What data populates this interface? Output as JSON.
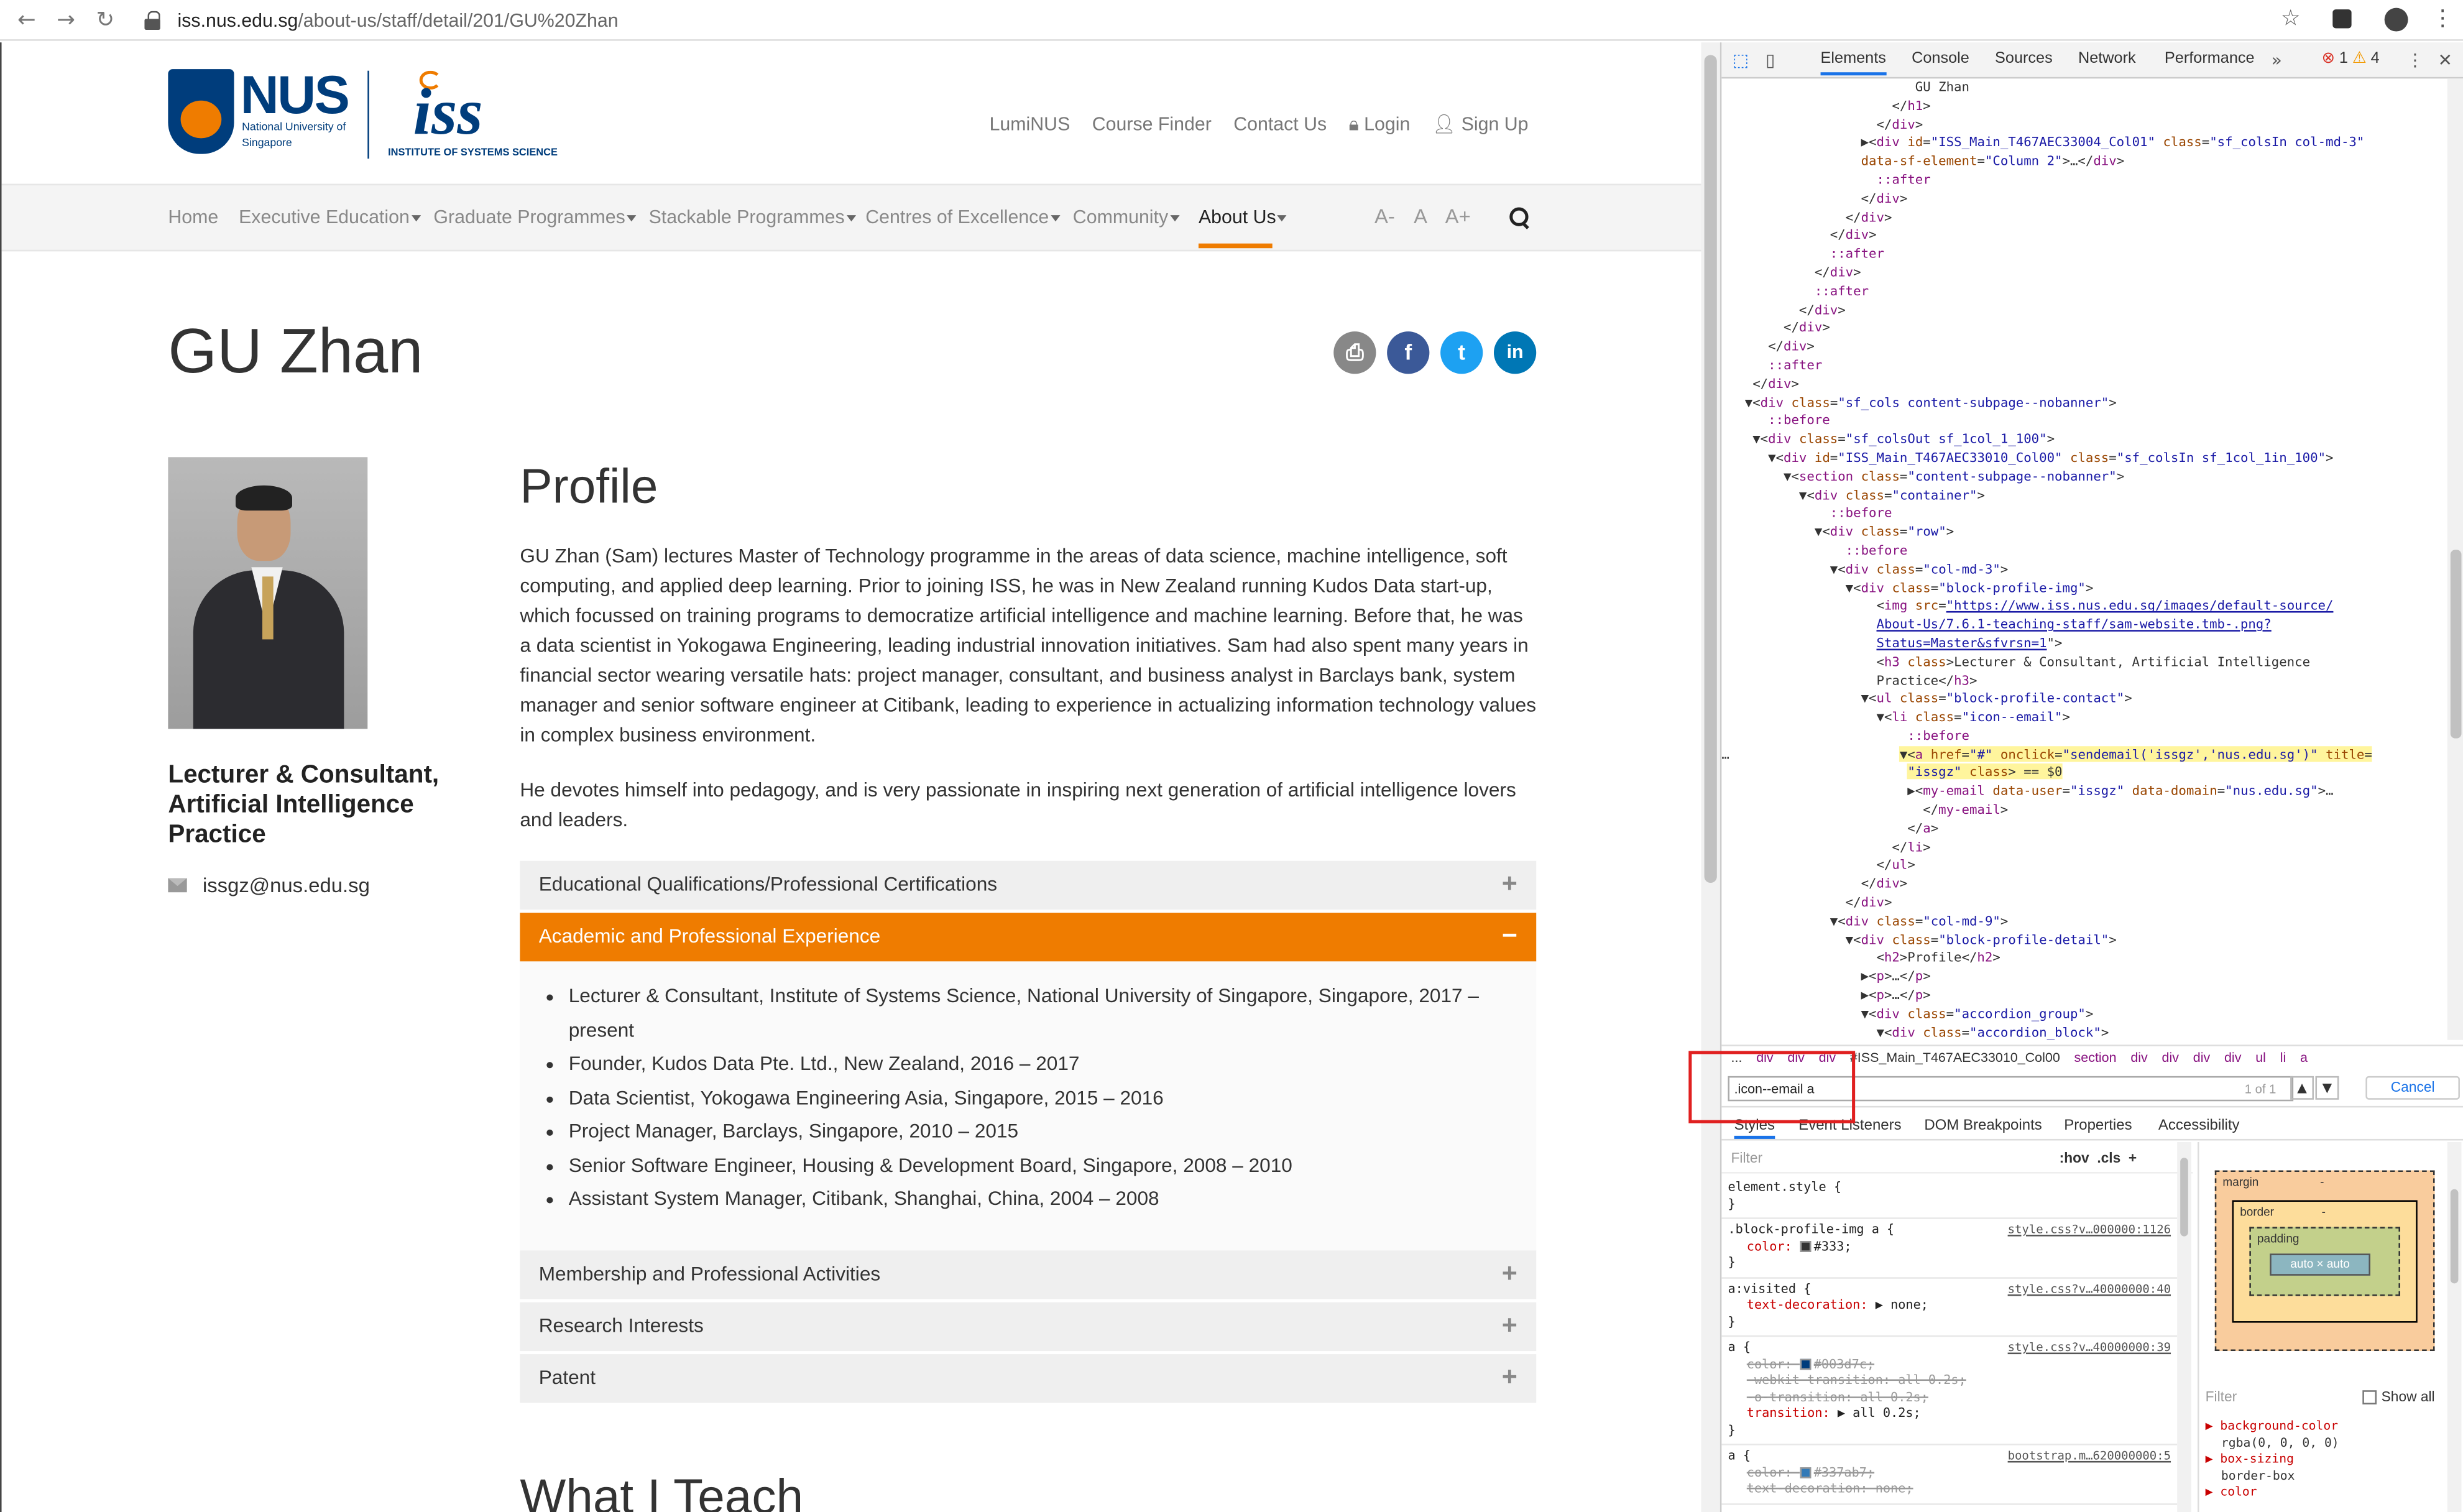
{
  "browser": {
    "url_host": "iss.nus.edu.sg",
    "url_path": "/about-us/staff/detail/201/GU%20Zhan"
  },
  "logos": {
    "nus_word": "NUS",
    "nus_sub": "National University of Singapore",
    "iss_word": "iss",
    "iss_sub": "INSTITUTE OF SYSTEMS SCIENCE"
  },
  "toplinks": [
    "LumiNUS",
    "Course Finder",
    "Contact Us",
    "Login",
    "Sign Up"
  ],
  "nav": {
    "items": [
      "Home",
      "Executive Education",
      "Graduate Programmes",
      "Stackable Programmes",
      "Centres of Excellence",
      "Community",
      "About Us"
    ],
    "active": "About Us",
    "font_sizes": [
      "A-",
      "A",
      "A+"
    ]
  },
  "profile": {
    "name": "GU Zhan",
    "title": "Lecturer & Consultant, Artificial Intelligence Practice",
    "email": "issgz@nus.edu.sg",
    "heading": "Profile",
    "para1": "GU Zhan (Sam) lectures Master of Technology programme in the areas of data science, machine intelligence, soft computing, and applied deep learning. Prior to joining ISS, he was in New Zealand running Kudos Data start-up, which focussed on training programs to democratize artificial intelligence and machine learning.  Before that, he was a data scientist in Yokogawa Engineering, leading industrial innovation initiatives.  Sam had also spent many years in financial sector wearing versatile hats: project manager, consultant, and business analyst in Barclays bank, system manager and senior software engineer at Citibank, leading to experience in actualizing information technology values in complex business environment.",
    "para2": "He devotes himself into pedagogy, and is very passionate in inspiring next generation of artificial intelligence lovers and leaders.",
    "accordion": [
      {
        "label": "Educational Qualifications/Professional Certifications",
        "sign": "+"
      },
      {
        "label": "Academic and Professional Experience",
        "sign": "−"
      },
      {
        "label": "Membership and Professional Activities",
        "sign": "+"
      },
      {
        "label": "Research Interests",
        "sign": "+"
      },
      {
        "label": "Patent",
        "sign": "+"
      }
    ],
    "experience": [
      "Lecturer & Consultant, Institute of Systems Science, National University of Singapore, Singapore, 2017 – present",
      "Founder, Kudos Data Pte. Ltd., New Zealand, 2016 – 2017",
      "Data Scientist, Yokogawa Engineering Asia, Singapore, 2015 – 2016",
      "Project Manager, Barclays, Singapore, 2010 – 2015",
      "Senior Software Engineer, Housing & Development Board, Singapore, 2008 – 2010",
      "Assistant System Manager, Citibank, Shanghai, China, 2004 – 2008"
    ],
    "next_heading": "What I Teach"
  },
  "devtools": {
    "tabs": [
      "Elements",
      "Console",
      "Sources",
      "Network",
      "Performance"
    ],
    "errors": "1",
    "warnings": "4",
    "breadcrumbs": [
      "...",
      "div",
      "div",
      "div",
      "#ISS_Main_T467AEC33010_Col00",
      "section",
      "div",
      "div",
      "div",
      "div",
      "ul",
      "li",
      "a"
    ],
    "find_value": ".icon--email a",
    "find_count": "1 of 1",
    "cancel": "Cancel",
    "style_tabs": [
      "Styles",
      "Event Listeners",
      "DOM Breakpoints",
      "Properties",
      "Accessibility"
    ],
    "filter_placeholder": "Filter",
    "hov": ":hov",
    "cls": ".cls",
    "box": {
      "margin": "margin",
      "border": "border",
      "padding": "padding",
      "content": "auto × auto",
      "dash": "-"
    },
    "show_all": "Show all",
    "computed": [
      {
        "k": "background-color",
        "v": "rgba(0, 0, 0, 0)"
      },
      {
        "k": "box-sizing",
        "v": "border-box"
      },
      {
        "k": "color",
        "v": ""
      }
    ]
  }
}
